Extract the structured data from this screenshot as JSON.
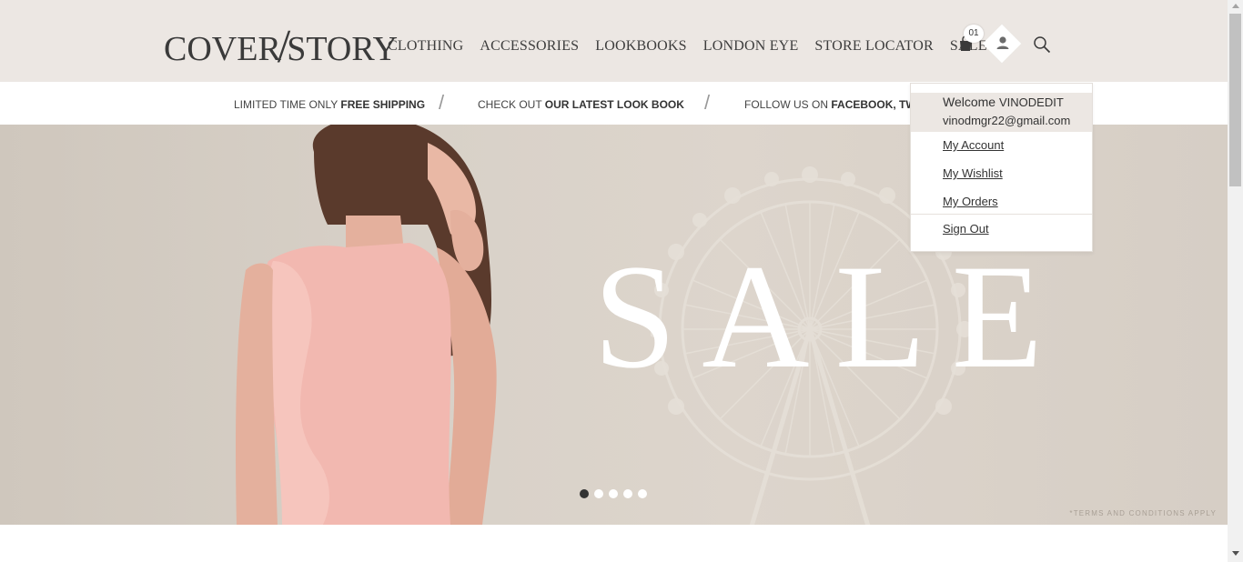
{
  "header": {
    "logo_left": "COVER",
    "logo_slash": "/",
    "logo_right": "STORY",
    "nav": [
      "CLOTHING",
      "ACCESSORIES",
      "LOOKBOOKS",
      "LONDON EYE",
      "STORE LOCATOR",
      "SALE"
    ],
    "cart_count": "01",
    "icons": [
      "shopping-bag-icon",
      "user-icon",
      "search-icon"
    ]
  },
  "promo": {
    "item1_prefix": "LIMITED TIME ONLY",
    "item1_bold": "FREE SHIPPING",
    "item2_prefix": "CHECK OUT",
    "item2_bold": "OUR LATEST LOOK BOOK",
    "item3_prefix": "FOLLOW US ON",
    "item3_bold": "FACEBOOK, TWITT",
    "separator": "/"
  },
  "hero": {
    "headline": "SALE",
    "terms": "*TERMS AND CONDITIONS APPLY",
    "slides_total": 5,
    "active_slide": 1
  },
  "user_menu": {
    "welcome_label": "Welcome",
    "username": "VINODEDIT",
    "email": "vinodmgr22@gmail.com",
    "items": [
      "My Account",
      "My Wishlist",
      "My Orders"
    ],
    "sign_out": "Sign Out"
  },
  "colors": {
    "header_bg": "#ece7e3",
    "hero_bg": "#d8d1c8",
    "text_dark": "#333333"
  }
}
